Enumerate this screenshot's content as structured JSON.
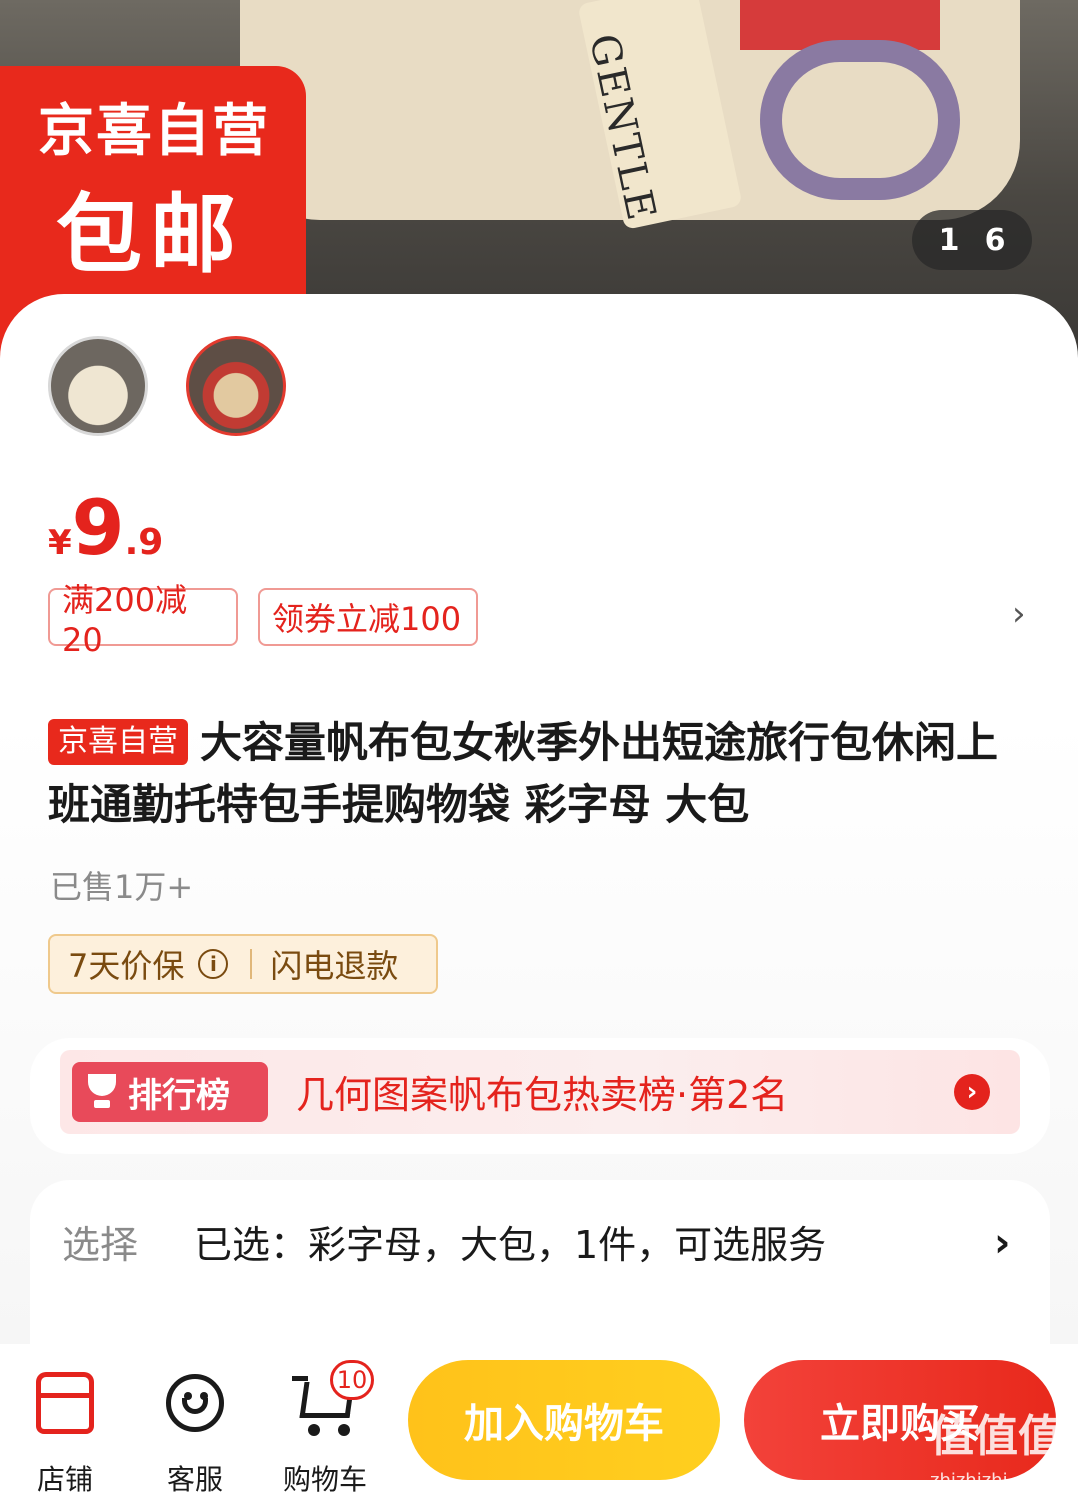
{
  "hero": {
    "word": "GENTLE",
    "counter_current": "1",
    "counter_total": "6"
  },
  "promo": {
    "line1": "京喜自营",
    "line2": "包邮"
  },
  "price": {
    "currency": "¥",
    "integer": "9",
    "decimal": ".9"
  },
  "coupons": [
    {
      "label": "满200减20"
    },
    {
      "label": "领券立减100"
    }
  ],
  "coupon_more": "›",
  "product": {
    "tag": "京喜自营",
    "title": "大容量帆布包女秋季外出短途旅行包休闲上班通勤托特包手提购物袋 彩字母 大包"
  },
  "sold": "已售1万+",
  "guarantee": {
    "price_protect": "7天价保",
    "info_symbol": "i",
    "refund": "闪电退款"
  },
  "ranking": {
    "badge": "排行榜",
    "text": "几何图案帆布包热卖榜·第2名",
    "go": "›"
  },
  "selection": {
    "label": "选择",
    "value": "已选：彩字母，大包，1件，可选服务",
    "arrow": "›"
  },
  "bottom_nav": {
    "store": "店铺",
    "service": "客服",
    "cart": "购物车",
    "cart_count": "10",
    "add_to_cart": "加入购物车",
    "buy_now": "立即购买"
  },
  "watermark": {
    "main": "值值值",
    "sub": "zhizhizhi.com"
  },
  "colors": {
    "accent": "#e4231d",
    "cart_button": "#ffc21a",
    "badge_red": "#e8291c"
  }
}
